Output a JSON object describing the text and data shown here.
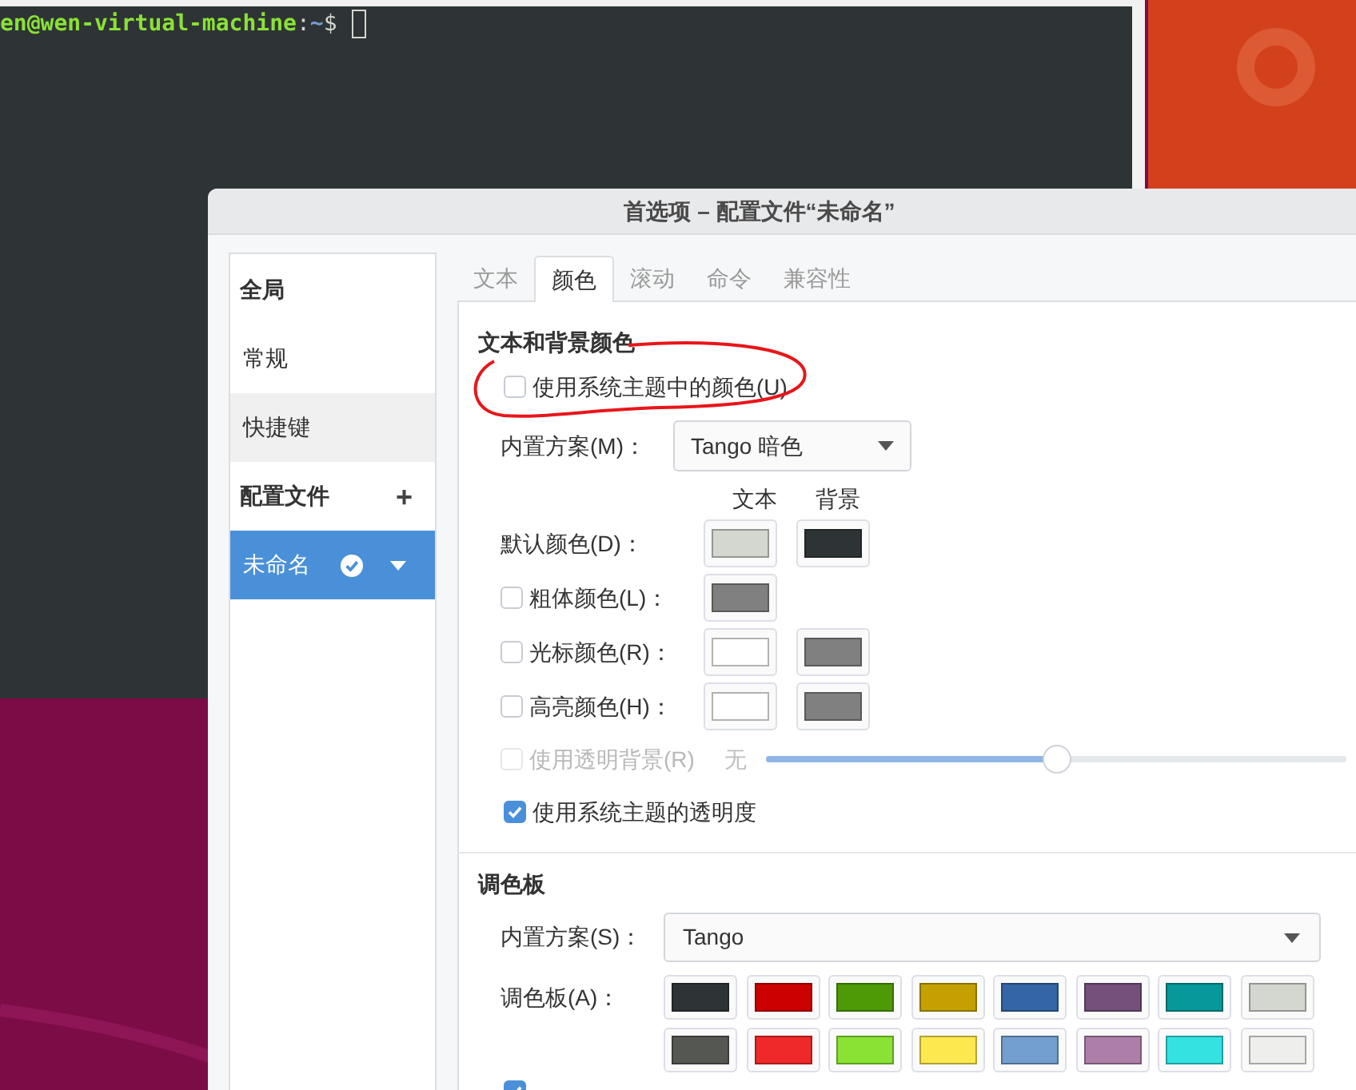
{
  "terminal": {
    "prompt_user": "en@wen-virtual-machine",
    "prompt_separator": ":",
    "prompt_path": "~",
    "prompt_symbol": "$"
  },
  "dialog": {
    "title": "首选项 – 配置文件“未命名”",
    "sidebar": {
      "items": [
        {
          "kind": "header",
          "label": "全局"
        },
        {
          "kind": "item",
          "label": "常规",
          "selected": false,
          "hovered": false
        },
        {
          "kind": "item",
          "label": "快捷键",
          "selected": false,
          "hovered": true
        },
        {
          "kind": "header",
          "label": "配置文件",
          "add": "+"
        },
        {
          "kind": "profile",
          "label": "未命名",
          "selected": true,
          "default": true
        }
      ]
    },
    "tabs": [
      {
        "label": "文本",
        "selected": false
      },
      {
        "label": "颜色",
        "selected": true
      },
      {
        "label": "滚动",
        "selected": false
      },
      {
        "label": "命令",
        "selected": false
      },
      {
        "label": "兼容性",
        "selected": false
      }
    ],
    "text_bg_section": {
      "title": "文本和背景颜色",
      "use_theme_colors": {
        "label": "使用系统主题中的颜色(U)",
        "checked": false
      },
      "builtin_scheme": {
        "label": "内置方案(M)：",
        "value": "Tango 暗色"
      },
      "column_headers": [
        "文本",
        "背景"
      ],
      "color_rows": [
        {
          "kind": "plain",
          "label": "默认颜色(D)：",
          "swatches": [
            {
              "color": "#d3d7cf"
            },
            {
              "color": "#2e3436"
            }
          ]
        },
        {
          "kind": "checkbox",
          "label": "粗体颜色(L)：",
          "checked": false,
          "swatches": [
            {
              "color": "#808080"
            }
          ]
        },
        {
          "kind": "checkbox",
          "label": "光标颜色(R)：",
          "checked": false,
          "swatches": [
            {
              "color": "#ffffff"
            },
            {
              "color": "#808080"
            }
          ]
        },
        {
          "kind": "checkbox",
          "label": "高亮颜色(H)：",
          "checked": false,
          "swatches": [
            {
              "color": "#ffffff"
            },
            {
              "color": "#808080"
            }
          ]
        }
      ],
      "transparent_background": {
        "label": "使用透明背景(R)",
        "checked": false,
        "disabled": true,
        "min_label": "无",
        "level": 0.5
      },
      "use_theme_transparency": {
        "label": "使用系统主题的透明度",
        "checked": true
      }
    },
    "palette_section": {
      "title": "调色板",
      "builtin_scheme": {
        "label": "内置方案(S)：",
        "value": "Tango"
      },
      "palette_label": "调色板(A)：",
      "colors": [
        {
          "color": "#2e3436"
        },
        {
          "color": "#cc0000"
        },
        {
          "color": "#4e9a06"
        },
        {
          "color": "#c4a000"
        },
        {
          "color": "#3465a4"
        },
        {
          "color": "#75507b"
        },
        {
          "color": "#06989a"
        },
        {
          "color": "#d3d7cf"
        },
        {
          "color": "#555753"
        },
        {
          "color": "#ef2929"
        },
        {
          "color": "#8ae234"
        },
        {
          "color": "#fce94f"
        },
        {
          "color": "#729fcf"
        },
        {
          "color": "#ad7fa8"
        },
        {
          "color": "#34e2e2"
        },
        {
          "color": "#eeeeec"
        }
      ],
      "next_checkbox": {
        "checked": true
      }
    }
  }
}
